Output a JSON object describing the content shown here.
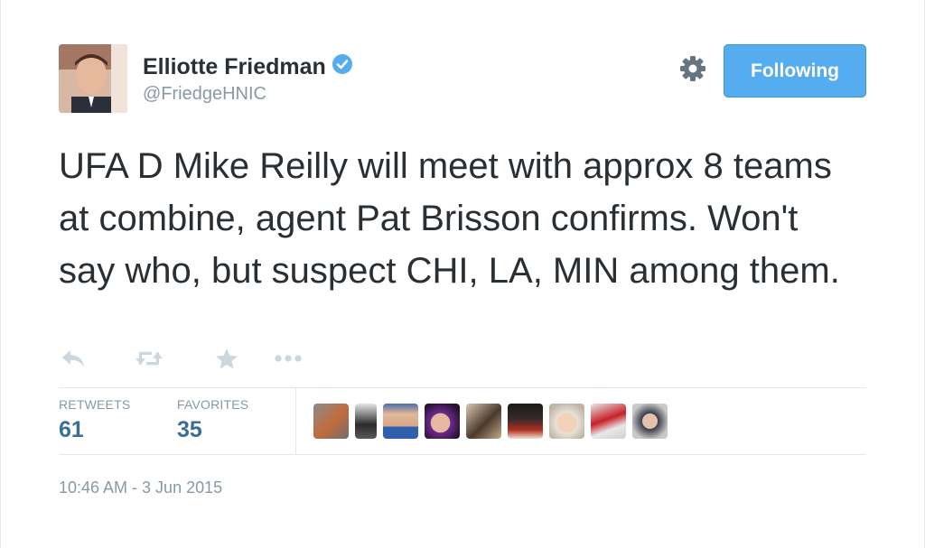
{
  "tweet": {
    "author_name": "Elliotte Friedman",
    "author_handle": "@FriedgeHNIC",
    "verified_icon": "verified-badge-icon",
    "follow_button_label": "Following",
    "text": "UFA D Mike Reilly will meet with approx 8 teams at combine, agent Pat Brisson confirms. Won't say who, but suspect CHI, LA, MIN among them.",
    "actions": [
      "reply-icon",
      "retweet-icon",
      "favorite-icon",
      "more-icon"
    ],
    "stats": {
      "retweets_label": "RETWEETS",
      "retweets_count": "61",
      "favorites_label": "FAVORITES",
      "favorites_count": "35"
    },
    "timestamp": "10:46 AM - 3 Jun 2015"
  },
  "colors": {
    "accent": "#55acee",
    "stat_value": "#3b6e96",
    "muted": "#8899a6",
    "text": "#292f33"
  }
}
